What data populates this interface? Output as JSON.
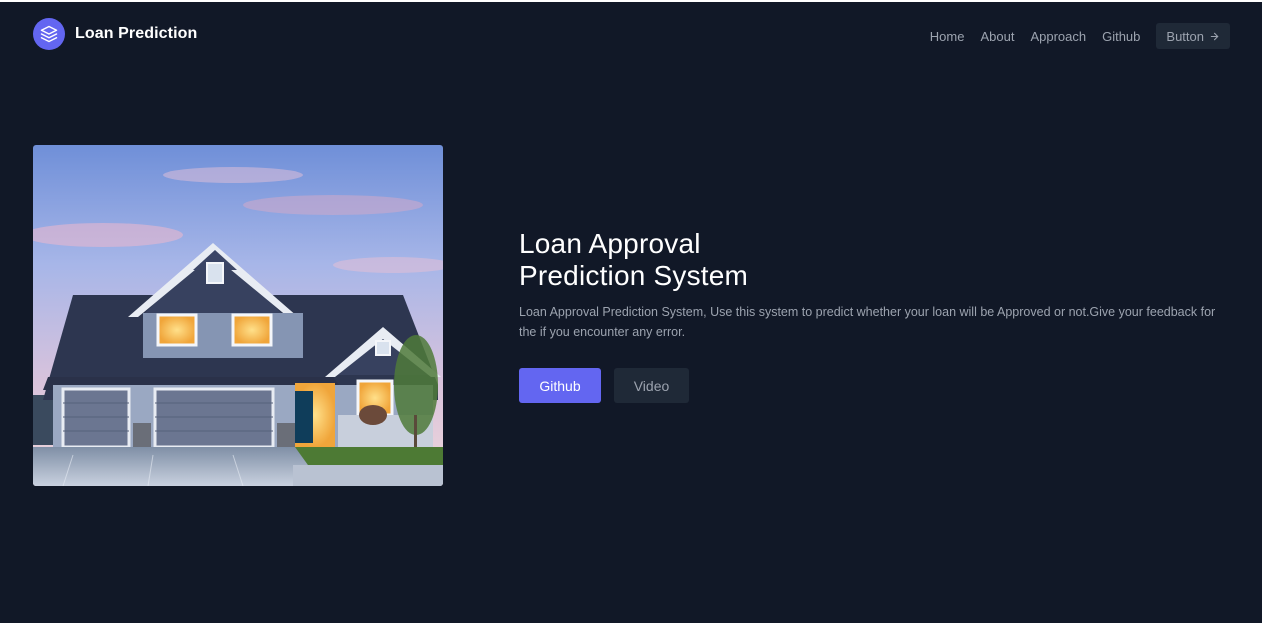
{
  "header": {
    "brand_name": "Loan Prediction",
    "logo_icon": "layers-icon",
    "nav": [
      {
        "label": "Home"
      },
      {
        "label": "About"
      },
      {
        "label": "Approach"
      },
      {
        "label": "Github"
      }
    ],
    "cta_label": "Button",
    "cta_icon": "arrow-right-icon"
  },
  "hero": {
    "image": "house-photo",
    "title_line1": "Loan Approval",
    "title_line2": "Prediction System",
    "description": "Loan Approval Prediction System, Use this system to predict whether your loan will be Approved or not.Give your feedback for the if you encounter any error.",
    "primary_button": "Github",
    "secondary_button": "Video"
  },
  "colors": {
    "background": "#111827",
    "accent": "#6366f1",
    "muted_text": "#9ca3af",
    "button_dark": "#1f2937"
  }
}
